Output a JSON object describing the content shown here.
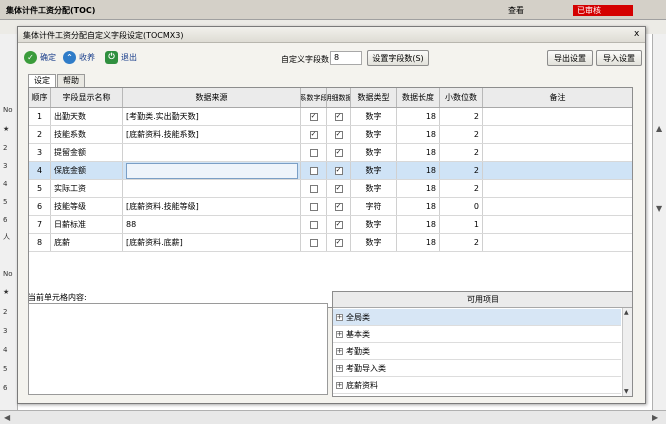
{
  "window": {
    "title": "集体计件工资分配(TOC)",
    "view_label": "查看",
    "status_badge": "已审核",
    "left_marks": [
      "No",
      "★",
      "2",
      "3",
      "4",
      "5",
      "6",
      "人",
      "No",
      "★",
      "2",
      "3",
      "4",
      "5",
      "6"
    ]
  },
  "dialog": {
    "title": "集体计件工资分配自定义字段设定(TOCMX3)",
    "close_glyph": "x",
    "toolbar": {
      "ok_label": "确定",
      "collapse_label": "收养",
      "exit_label": "退出"
    },
    "field_count_label": "自定义字段数",
    "field_count_value": "8",
    "set_field_button": "设置字段数(S)",
    "export_button": "导出设置",
    "import_button": "导入设置",
    "tabs": [
      {
        "label": "设定",
        "active": true
      },
      {
        "label": "帮助",
        "active": false
      }
    ]
  },
  "grid": {
    "headers": [
      "顺序",
      "字段显示名称",
      "数据来源",
      "系数字段",
      "明细数据",
      "数据类型",
      "数据长度",
      "小数位数",
      "备注"
    ],
    "rows": [
      {
        "order": "1",
        "name": "出勤天数",
        "source": "[考勤类.实出勤天数]",
        "coef": true,
        "detail": true,
        "type": "数字",
        "length": "18",
        "decimals": "2",
        "note": ""
      },
      {
        "order": "2",
        "name": "技能系数",
        "source": "[底薪资料.技能系数]",
        "coef": true,
        "detail": true,
        "type": "数字",
        "length": "18",
        "decimals": "2",
        "note": ""
      },
      {
        "order": "3",
        "name": "提留金额",
        "source": "",
        "coef": false,
        "detail": true,
        "type": "数字",
        "length": "18",
        "decimals": "2",
        "note": ""
      },
      {
        "order": "4",
        "name": "保底金额",
        "source": "",
        "coef": false,
        "detail": true,
        "type": "数字",
        "length": "18",
        "decimals": "2",
        "note": ""
      },
      {
        "order": "5",
        "name": "实际工资",
        "source": "",
        "coef": false,
        "detail": true,
        "type": "数字",
        "length": "18",
        "decimals": "2",
        "note": ""
      },
      {
        "order": "6",
        "name": "技能等级",
        "source": "[底薪资料.技能等级]",
        "coef": false,
        "detail": true,
        "type": "字符",
        "length": "18",
        "decimals": "0",
        "note": ""
      },
      {
        "order": "7",
        "name": "日薪标准",
        "source": "88",
        "coef": false,
        "detail": true,
        "type": "数字",
        "length": "18",
        "decimals": "1",
        "note": ""
      },
      {
        "order": "8",
        "name": "底薪",
        "source": "[底薪资料.底薪]",
        "coef": false,
        "detail": true,
        "type": "数字",
        "length": "18",
        "decimals": "2",
        "note": ""
      }
    ],
    "selected_row": 4
  },
  "cell_content": {
    "label": "当前单元格内容:"
  },
  "available": {
    "title": "可用项目",
    "items": [
      {
        "label": "全局类",
        "selected": true
      },
      {
        "label": "基本类",
        "selected": false
      },
      {
        "label": "考勤类",
        "selected": false
      },
      {
        "label": "考勤导入类",
        "selected": false
      },
      {
        "label": "底薪资料",
        "selected": false
      }
    ]
  },
  "colors": {
    "badge": "#d40000",
    "selection": "#cfe3f6",
    "dialog_bg": "#f4f3ee"
  }
}
